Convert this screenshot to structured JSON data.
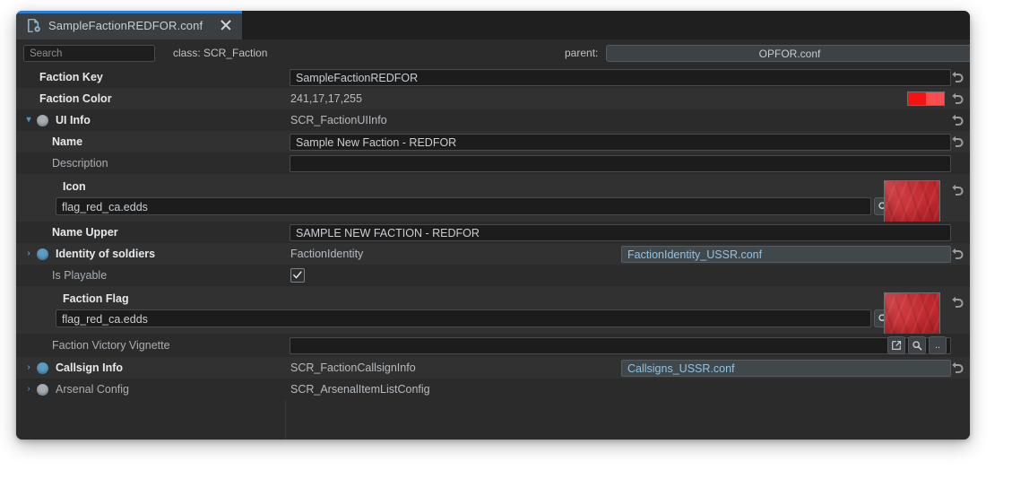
{
  "window": {
    "tab": {
      "label": "SampleFactionREDFOR.conf",
      "file_icon": "file-gear-icon",
      "close_icon": "close-icon",
      "accent_color": "#2a7fd4"
    }
  },
  "toolbar": {
    "search_placeholder": "Search",
    "search_value": "",
    "class_label": "class: SCR_Faction",
    "parent_label": "parent:",
    "parent_value": "OPFOR.conf"
  },
  "properties": {
    "faction_key": {
      "label": "Faction Key",
      "value": "SampleFactionREDFOR"
    },
    "faction_color": {
      "label": "Faction Color",
      "value": "241,17,17,255",
      "swatch_left": "#f51212",
      "swatch_right": "#fb4d4d"
    },
    "ui_info": {
      "label": "UI Info",
      "value": "SCR_FactionUIInfo"
    },
    "name": {
      "label": "Name",
      "value": "Sample New Faction - REDFOR"
    },
    "description": {
      "label": "Description",
      "value": ""
    },
    "icon": {
      "label": "Icon",
      "path": "flag_red_ca.edds"
    },
    "name_upper": {
      "label": "Name Upper",
      "value": "SAMPLE NEW FACTION - REDFOR"
    },
    "identity": {
      "label": "Identity of soldiers",
      "value": "FactionIdentity",
      "ref": "FactionIdentity_USSR.conf"
    },
    "is_playable": {
      "label": "Is Playable",
      "checked": true
    },
    "faction_flag": {
      "label": "Faction Flag",
      "path": "flag_red_ca.edds"
    },
    "victory_vignette": {
      "label": "Faction Victory Vignette",
      "value": ""
    },
    "callsign_info": {
      "label": "Callsign Info",
      "value": "SCR_FactionCallsignInfo",
      "ref": "Callsigns_USSR.conf"
    },
    "arsenal_config": {
      "label": "Arsenal Config",
      "value": "SCR_ArsenalItemListConfig"
    }
  },
  "icons": {
    "revert": "revert-icon",
    "search_small": "magnifier-icon",
    "browse": "..",
    "open_external": "open-external-icon",
    "expand_collapse_open": "▾",
    "expand_collapse_closed": "›"
  }
}
